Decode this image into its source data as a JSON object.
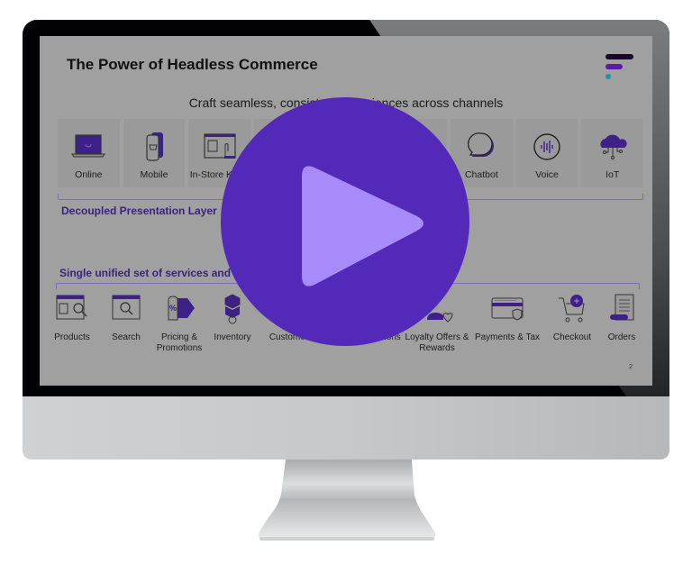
{
  "slide": {
    "title": "The Power of Headless Commerce",
    "subtitle": "Craft seamless, consistent experiences across channels",
    "page_number": "2",
    "channels": [
      {
        "label": "Online",
        "icon": "laptop-icon"
      },
      {
        "label": "Mobile",
        "icon": "mobile-cart-icon"
      },
      {
        "label": "In-Store Kiosk",
        "icon": "kiosk-touch-icon"
      },
      {
        "label": "",
        "icon": "hidden-channel-icon"
      },
      {
        "label": "",
        "icon": "hidden-channel-icon"
      },
      {
        "label": "",
        "icon": "hidden-channel-icon"
      },
      {
        "label": "Chatbot",
        "icon": "chat-bubble-icon"
      },
      {
        "label": "Voice",
        "icon": "voice-wave-icon"
      },
      {
        "label": "IoT",
        "icon": "cloud-iot-icon"
      }
    ],
    "presentation_layer_label": "Decoupled Presentation Layer",
    "services_label": "Single unified set of services and data",
    "services": [
      {
        "label": "Products",
        "icon": "product-browse-icon"
      },
      {
        "label": "Search",
        "icon": "search-window-icon"
      },
      {
        "label": "Pricing & Promotions",
        "icon": "price-tag-icon"
      },
      {
        "label": "Inventory",
        "icon": "boxes-icon"
      },
      {
        "label": "Customers",
        "icon": "customer-icon"
      },
      {
        "label": "Recommendations",
        "icon": "recommendation-icon"
      },
      {
        "label": "Loyalty Offers & Rewards",
        "icon": "loyalty-heart-icon"
      },
      {
        "label": "Payments & Tax",
        "icon": "credit-card-shield-icon"
      },
      {
        "label": "Checkout",
        "icon": "cart-plus-icon"
      },
      {
        "label": "Orders",
        "icon": "order-receipt-icon"
      }
    ]
  },
  "video": {
    "play_button_label": "Play video",
    "play_icon": "play-icon"
  },
  "colors": {
    "accent": "#5229b8",
    "play_triangle": "#a78bfa",
    "section_text": "#3a2380",
    "logo_dark": "#150a2a",
    "logo_purple": "#5c1aa8",
    "logo_teal": "#1a93b0"
  }
}
